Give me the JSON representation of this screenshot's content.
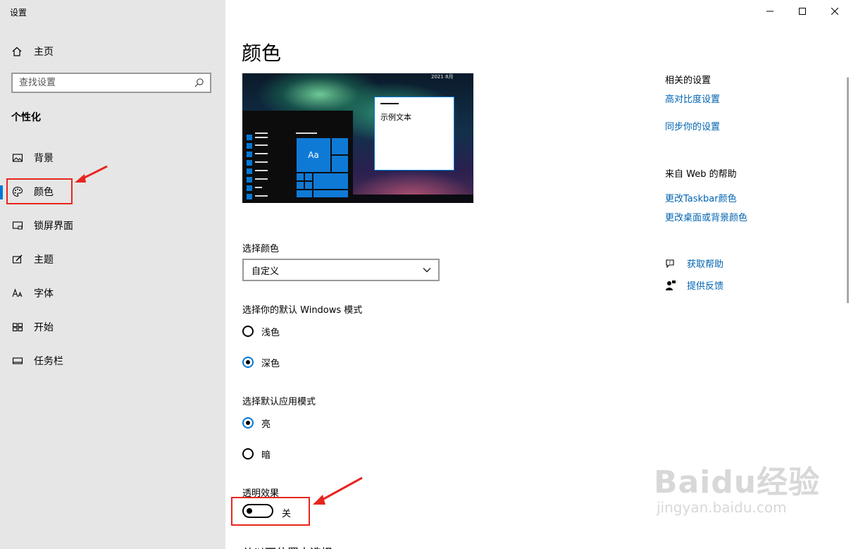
{
  "window": {
    "title": "设置"
  },
  "sidebar": {
    "home_label": "主页",
    "search_placeholder": "查找设置",
    "section_title": "个性化",
    "items": [
      {
        "label": "背景",
        "icon": "picture-icon"
      },
      {
        "label": "颜色",
        "icon": "palette-icon",
        "active": true
      },
      {
        "label": "锁屏界面",
        "icon": "lock-screen-icon"
      },
      {
        "label": "主题",
        "icon": "theme-brush-icon"
      },
      {
        "label": "字体",
        "icon": "font-icon"
      },
      {
        "label": "开始",
        "icon": "start-grid-icon"
      },
      {
        "label": "任务栏",
        "icon": "taskbar-icon"
      }
    ]
  },
  "main": {
    "title": "颜色",
    "preview": {
      "clock_text": "2021 8月",
      "tile_text": "Aa",
      "sample_window_text": "示例文本"
    },
    "choose_color": {
      "label": "选择颜色",
      "selected": "自定义"
    },
    "windows_mode": {
      "label": "选择你的默认 Windows 模式",
      "options": [
        {
          "label": "浅色",
          "checked": false
        },
        {
          "label": "深色",
          "checked": true
        }
      ]
    },
    "app_mode": {
      "label": "选择默认应用模式",
      "options": [
        {
          "label": "亮",
          "checked": false
        },
        {
          "label": "暗",
          "checked": false
        }
      ]
    },
    "transparency": {
      "label": "透明效果",
      "state_label": "关",
      "on": false
    },
    "next_section_partial": "从以下位置中选择"
  },
  "right_panel": {
    "related_heading": "相关的设置",
    "related_links": [
      "高对比度设置",
      "同步你的设置"
    ],
    "web_help_heading": "来自 Web 的帮助",
    "web_links": [
      "更改Taskbar颜色",
      "更改桌面或背景颜色"
    ],
    "get_help": "获取帮助",
    "feedback": "提供反馈"
  },
  "watermark": {
    "brand": "Baidu经验",
    "url": "jingyan.baidu.com"
  },
  "colors": {
    "accent": "#0078d7",
    "link": "#0063b1",
    "annotation": "#e8251f",
    "sidebar_bg": "#e6e6e6"
  }
}
